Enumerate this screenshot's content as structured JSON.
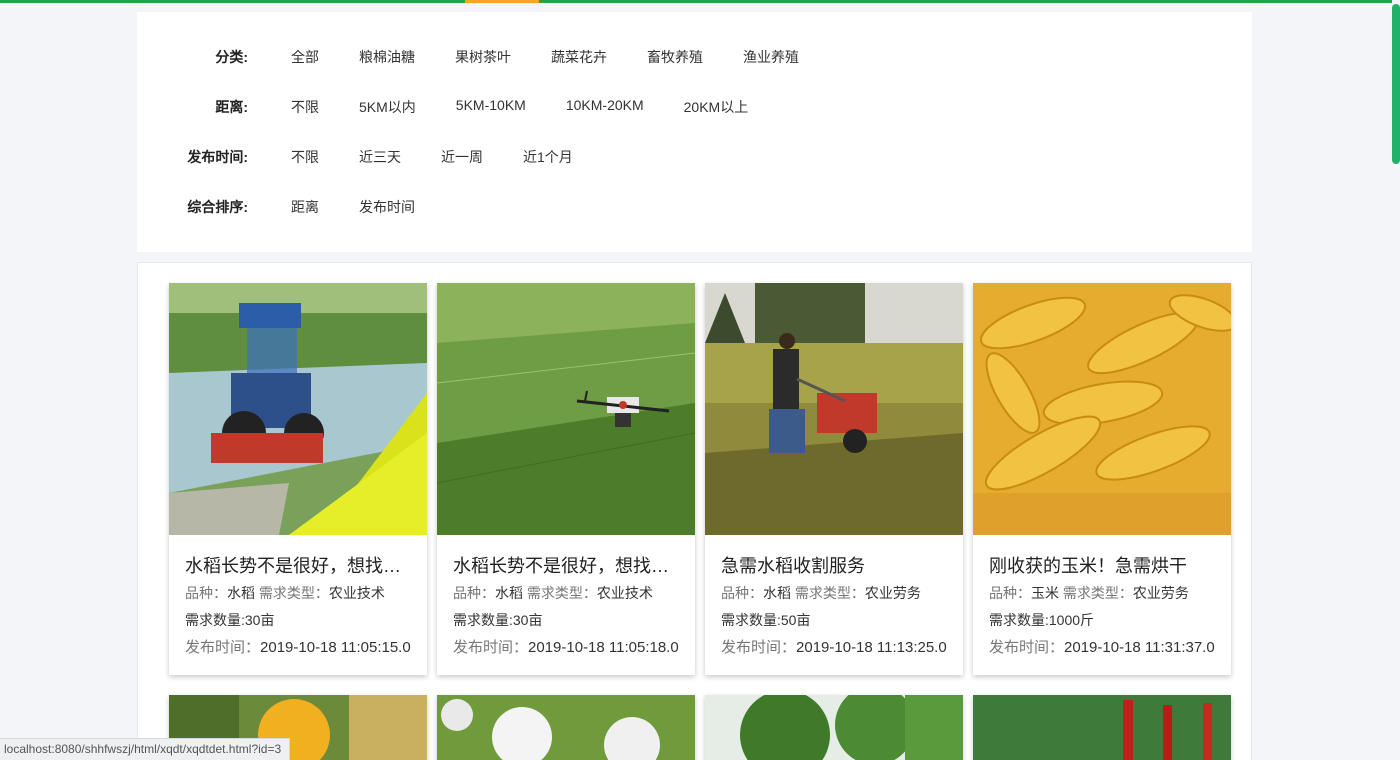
{
  "filters": {
    "category": {
      "label": "分类:",
      "options": [
        "全部",
        "粮棉油糖",
        "果树茶叶",
        "蔬菜花卉",
        "畜牧养殖",
        "渔业养殖"
      ]
    },
    "distance": {
      "label": "距离:",
      "options": [
        "不限",
        "5KM以内",
        "5KM-10KM",
        "10KM-20KM",
        "20KM以上"
      ]
    },
    "publish_time": {
      "label": "发布时间:",
      "options": [
        "不限",
        "近三天",
        "近一周",
        "近1个月"
      ]
    },
    "sort": {
      "label": "综合排序:",
      "options": [
        "距离",
        "发布时间"
      ]
    }
  },
  "cards": [
    {
      "title": "水稻长势不是很好，想找农业技术指导",
      "variety_key": "品种：",
      "variety": "水稻",
      "type_key": "需求类型：",
      "type": "农业技术",
      "quantity": "需求数量:30亩",
      "time_key": "发布时间：",
      "time": "2019-10-18 11:05:15.0",
      "image": "tractor-in-field"
    },
    {
      "title": "水稻长势不是很好，想找农业技术指导",
      "variety_key": "品种：",
      "variety": "水稻",
      "type_key": "需求类型：",
      "type": "农业技术",
      "quantity": "需求数量:30亩",
      "time_key": "发布时间：",
      "time": "2019-10-18 11:05:18.0",
      "image": "drone-over-field"
    },
    {
      "title": "急需水稻收割服务",
      "variety_key": "品种：",
      "variety": "水稻",
      "type_key": "需求类型：",
      "type": "农业劳务",
      "quantity": "需求数量:50亩",
      "time_key": "发布时间：",
      "time": "2019-10-18 11:13:25.0",
      "image": "rice-harvester"
    },
    {
      "title": "刚收获的玉米！急需烘干",
      "variety_key": "品种：",
      "variety": "玉米",
      "type_key": "需求类型：",
      "type": "农业劳务",
      "quantity": "需求数量:1000斤",
      "time_key": "发布时间：",
      "time": "2019-10-18 11:31:37.0",
      "image": "corn-pile"
    }
  ],
  "status_url": "localhost:8080/shhfwszj/html/xqdt/xqdtdet.html?id=3",
  "colors": {
    "brand_green": "#27a244",
    "accent_orange": "#f5a623",
    "scrollbar": "#1fb36a"
  }
}
